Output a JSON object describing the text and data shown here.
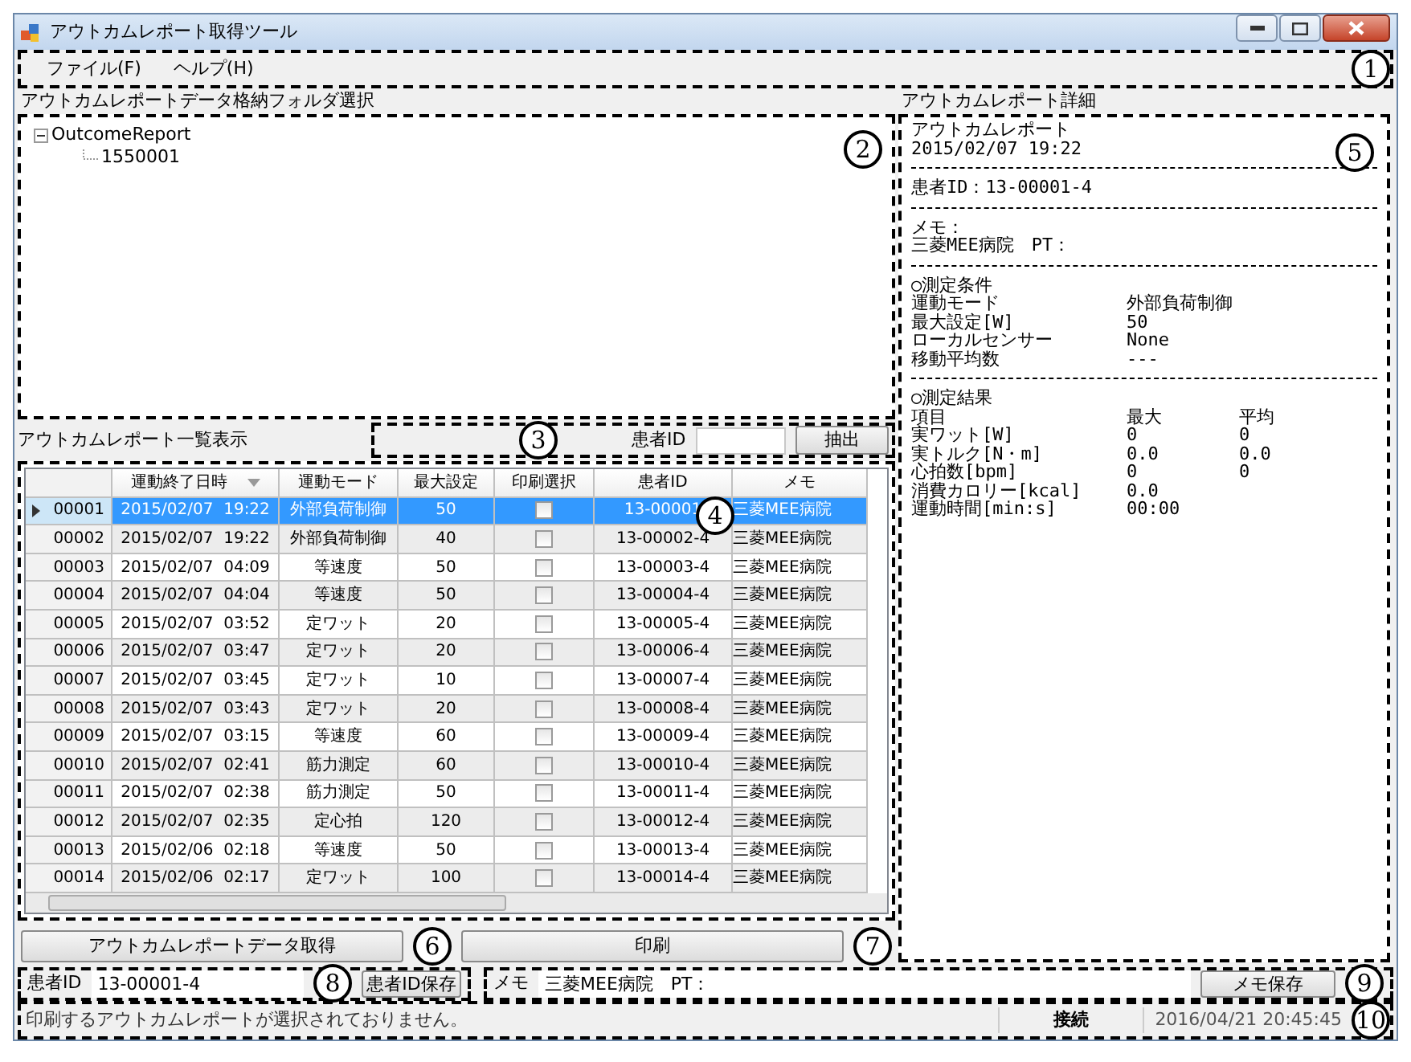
{
  "window": {
    "title": "アウトカムレポート取得ツール"
  },
  "menu": {
    "callout": "1",
    "items": [
      {
        "label": "ファイル(F)"
      },
      {
        "label": "ヘルプ(H)"
      }
    ]
  },
  "folder_panel": {
    "title": "アウトカムレポートデータ格納フォルダ選択",
    "callout": "2",
    "tree": [
      {
        "label": "OutcomeReport",
        "expanded": true,
        "children": [
          {
            "label": "1550001"
          }
        ]
      }
    ]
  },
  "list_panel": {
    "title": "アウトカムレポート一覧表示",
    "filter": {
      "label": "患者ID",
      "button": "抽出",
      "callout": "3"
    }
  },
  "table": {
    "callout": "4",
    "columns": [
      {
        "label": "運動終了日時",
        "sorted": true
      },
      {
        "label": "運動モード",
        "sorted": false
      },
      {
        "label": "最大設定",
        "sorted": false
      },
      {
        "label": "印刷選択",
        "sorted": false
      },
      {
        "label": "患者ID",
        "sorted": false
      },
      {
        "label": "メモ",
        "sorted": false
      }
    ],
    "rows": [
      {
        "number": "00001",
        "end_time": "2015/02/07  19:22",
        "mode": "外部負荷制御",
        "max": "50",
        "print": false,
        "patient_id": "13-00001",
        "memo": "三菱MEE病院",
        "selected": true
      },
      {
        "number": "00002",
        "end_time": "2015/02/07  19:22",
        "mode": "外部負荷制御",
        "max": "40",
        "print": false,
        "patient_id": "13-00002-4",
        "memo": "三菱MEE病院",
        "selected": false
      },
      {
        "number": "00003",
        "end_time": "2015/02/07  04:09",
        "mode": "等速度",
        "max": "50",
        "print": false,
        "patient_id": "13-00003-4",
        "memo": "三菱MEE病院",
        "selected": false
      },
      {
        "number": "00004",
        "end_time": "2015/02/07  04:04",
        "mode": "等速度",
        "max": "50",
        "print": false,
        "patient_id": "13-00004-4",
        "memo": "三菱MEE病院",
        "selected": false
      },
      {
        "number": "00005",
        "end_time": "2015/02/07  03:52",
        "mode": "定ワット",
        "max": "20",
        "print": false,
        "patient_id": "13-00005-4",
        "memo": "三菱MEE病院",
        "selected": false
      },
      {
        "number": "00006",
        "end_time": "2015/02/07  03:47",
        "mode": "定ワット",
        "max": "20",
        "print": false,
        "patient_id": "13-00006-4",
        "memo": "三菱MEE病院",
        "selected": false
      },
      {
        "number": "00007",
        "end_time": "2015/02/07  03:45",
        "mode": "定ワット",
        "max": "10",
        "print": false,
        "patient_id": "13-00007-4",
        "memo": "三菱MEE病院",
        "selected": false
      },
      {
        "number": "00008",
        "end_time": "2015/02/07  03:43",
        "mode": "定ワット",
        "max": "20",
        "print": false,
        "patient_id": "13-00008-4",
        "memo": "三菱MEE病院",
        "selected": false
      },
      {
        "number": "00009",
        "end_time": "2015/02/07  03:15",
        "mode": "等速度",
        "max": "60",
        "print": false,
        "patient_id": "13-00009-4",
        "memo": "三菱MEE病院",
        "selected": false
      },
      {
        "number": "00010",
        "end_time": "2015/02/07  02:41",
        "mode": "筋力測定",
        "max": "60",
        "print": false,
        "patient_id": "13-00010-4",
        "memo": "三菱MEE病院",
        "selected": false
      },
      {
        "number": "00011",
        "end_time": "2015/02/07  02:38",
        "mode": "筋力測定",
        "max": "50",
        "print": false,
        "patient_id": "13-00011-4",
        "memo": "三菱MEE病院",
        "selected": false
      },
      {
        "number": "00012",
        "end_time": "2015/02/07  02:35",
        "mode": "定心拍",
        "max": "120",
        "print": false,
        "patient_id": "13-00012-4",
        "memo": "三菱MEE病院",
        "selected": false
      },
      {
        "number": "00013",
        "end_time": "2015/02/06  02:18",
        "mode": "等速度",
        "max": "50",
        "print": false,
        "patient_id": "13-00013-4",
        "memo": "三菱MEE病院",
        "selected": false
      },
      {
        "number": "00014",
        "end_time": "2015/02/06  02:17",
        "mode": "定ワット",
        "max": "100",
        "print": false,
        "patient_id": "13-00014-4",
        "memo": "三菱MEE病院",
        "selected": false
      }
    ]
  },
  "detail": {
    "title": "アウトカムレポート詳細",
    "callout": "5",
    "lines": [
      {
        "kind": "text",
        "cells": [
          "アウトカムレポート"
        ]
      },
      {
        "kind": "text",
        "cells": [
          "2015/02/07 19:22"
        ]
      },
      {
        "kind": "rule"
      },
      {
        "kind": "text",
        "cells": [
          "患者ID：13-00001-4"
        ]
      },
      {
        "kind": "rule"
      },
      {
        "kind": "text",
        "cells": [
          "メモ："
        ]
      },
      {
        "kind": "text",
        "cells": [
          "三菱MEE病院　PT："
        ]
      },
      {
        "kind": "rule"
      },
      {
        "kind": "text",
        "cells": [
          "○測定条件"
        ]
      },
      {
        "kind": "text",
        "cells": [
          "運動モード",
          "外部負荷制御"
        ]
      },
      {
        "kind": "text",
        "cells": [
          "最大設定[W]",
          "50"
        ]
      },
      {
        "kind": "text",
        "cells": [
          "ローカルセンサー",
          "None"
        ]
      },
      {
        "kind": "text",
        "cells": [
          "移動平均数",
          "---"
        ]
      },
      {
        "kind": "rule"
      },
      {
        "kind": "text",
        "cells": [
          "○測定結果"
        ]
      },
      {
        "kind": "text",
        "cells": [
          "項目",
          "最大",
          "平均"
        ]
      },
      {
        "kind": "text",
        "cells": [
          "実ワット[W]",
          "0",
          "0"
        ]
      },
      {
        "kind": "text",
        "cells": [
          "実トルク[N・m]",
          "0.0",
          "0.0"
        ]
      },
      {
        "kind": "text",
        "cells": [
          "心拍数[bpm]",
          "0",
          "0"
        ]
      },
      {
        "kind": "text",
        "cells": [
          "消費カロリー[kcal]",
          "0.0"
        ]
      },
      {
        "kind": "text",
        "cells": [
          "運動時間[min:s]",
          "00:00"
        ]
      }
    ]
  },
  "actions": [
    {
      "label": "アウトカムレポートデータ取得",
      "callout": "6"
    },
    {
      "label": "印刷",
      "callout": "7"
    }
  ],
  "patient": {
    "label": "患者ID",
    "value": "13-00001-4",
    "button": "患者ID保存",
    "callout": "8"
  },
  "memo": {
    "label": "メモ",
    "value": "三菱MEE病院　PT：",
    "button": "メモ保存",
    "callout": "9"
  },
  "status_bar": {
    "message": "印刷するアウトカムレポートが選択されておりません。",
    "connection": "接続",
    "datetime": "2016/04/21 20:45:45",
    "callout": "10"
  }
}
